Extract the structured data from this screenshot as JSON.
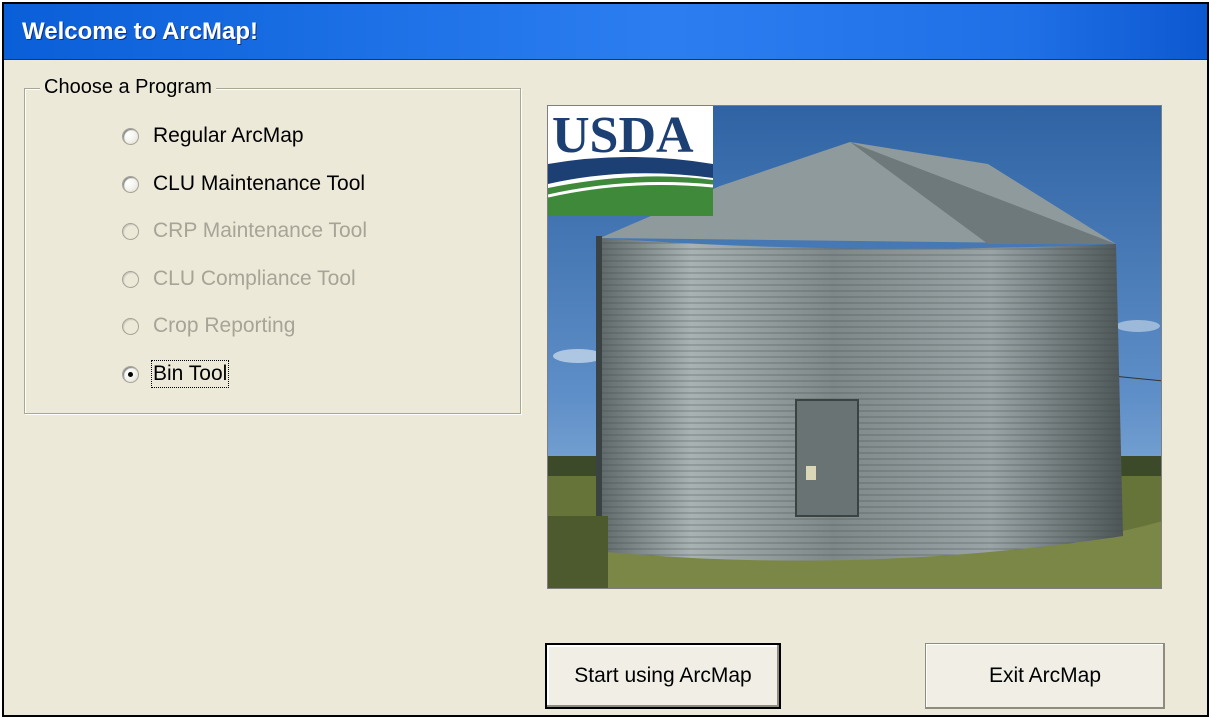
{
  "window": {
    "title": "Welcome to ArcMap!"
  },
  "group": {
    "legend": "Choose a Program",
    "options": [
      {
        "label": "Regular ArcMap",
        "enabled": true,
        "selected": false
      },
      {
        "label": "CLU Maintenance Tool",
        "enabled": true,
        "selected": false
      },
      {
        "label": "CRP Maintenance Tool",
        "enabled": false,
        "selected": false
      },
      {
        "label": "CLU Compliance Tool",
        "enabled": false,
        "selected": false
      },
      {
        "label": "Crop Reporting",
        "enabled": false,
        "selected": false
      },
      {
        "label": "Bin Tool",
        "enabled": true,
        "selected": true
      }
    ]
  },
  "image": {
    "logo_text": "USDA",
    "subject": "grain bin"
  },
  "buttons": {
    "start_label": "Start using ArcMap",
    "exit_label": "Exit ArcMap"
  },
  "colors": {
    "titlebar": "#1f6fe6",
    "dialog_bg": "#ece9d8",
    "disabled_text": "#a7a497",
    "usda_blue": "#1c3f74",
    "usda_green": "#3f8a3a"
  }
}
